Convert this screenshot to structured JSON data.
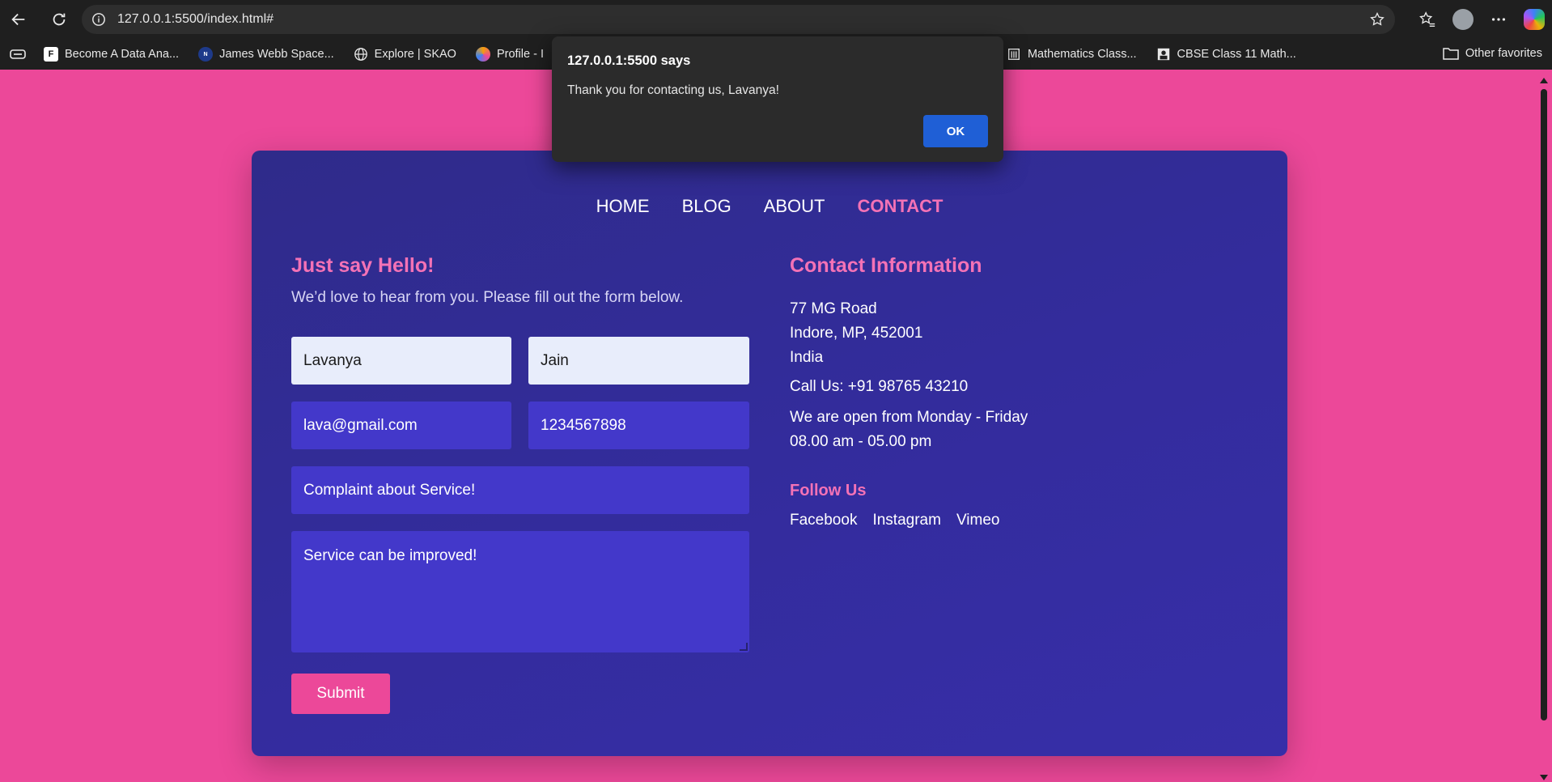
{
  "browser": {
    "url": "127.0.0.1:5500/index.html#",
    "bookmarks": [
      {
        "label": "Become A Data Ana...",
        "icon": "data-analyst-favicon"
      },
      {
        "label": "James Webb Space...",
        "icon": "nasa-favicon"
      },
      {
        "label": "Explore | SKAO",
        "icon": "globe-icon"
      },
      {
        "label": "Profile - I",
        "icon": "profile-favicon"
      },
      {
        "label": "Mathematics Class...",
        "icon": "institution-icon"
      },
      {
        "label": "CBSE Class 11 Math...",
        "icon": "teacher-icon"
      }
    ],
    "other_favorites": "Other favorites"
  },
  "nav": {
    "items": [
      "HOME",
      "BLOG",
      "ABOUT",
      "CONTACT"
    ],
    "active": "CONTACT"
  },
  "form": {
    "heading": "Just say Hello!",
    "intro": "We’d love to hear from you. Please fill out the form below.",
    "first_name": "Lavanya",
    "last_name": "Jain",
    "email": "lava@gmail.com",
    "phone": "1234567898",
    "subject": "Complaint about Service!",
    "message": "Service can be improved!",
    "submit_label": "Submit"
  },
  "contact": {
    "heading": "Contact Information",
    "address_line1": "77 MG Road",
    "address_line2": "Indore, MP, 452001",
    "address_line3": "India",
    "phone": "Call Us: +91 98765 43210",
    "hours_line1": "We are open from Monday - Friday",
    "hours_line2": "08.00 am - 05.00 pm",
    "follow_heading": "Follow Us",
    "social": [
      "Facebook",
      "Instagram",
      "Vimeo"
    ]
  },
  "alert": {
    "title": "127.0.0.1:5500 says",
    "message": "Thank you for contacting us, Lavanya!",
    "ok_label": "OK"
  },
  "colors": {
    "page_bg": "#ec4899",
    "card_bg": "#332c9c",
    "accent_pink": "#f472b6",
    "input_dark": "#4338ca",
    "input_light": "#e8edfb",
    "dialog_ok": "#1f5fd6"
  }
}
